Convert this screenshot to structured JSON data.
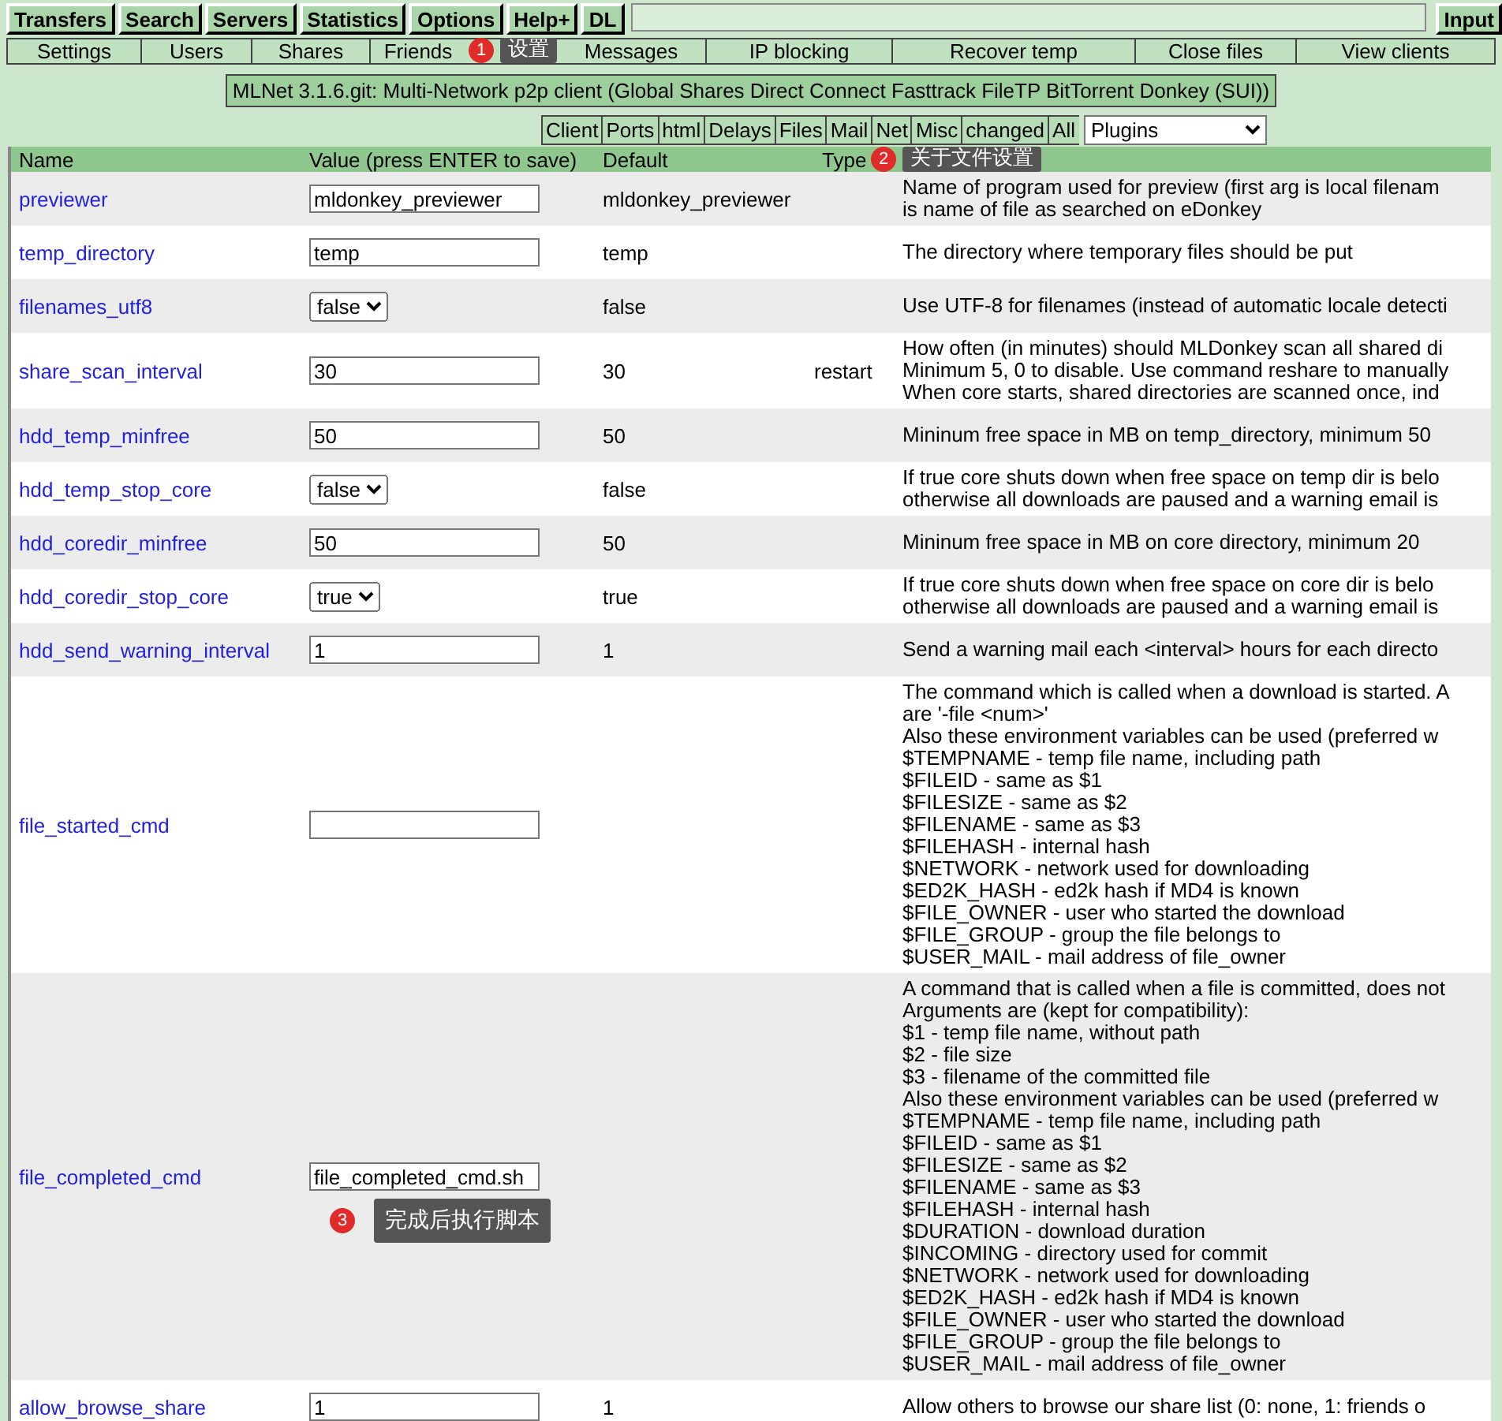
{
  "top_menu": [
    "Transfers",
    "Search",
    "Servers",
    "Statistics",
    "Options",
    "Help+",
    "DL"
  ],
  "input_button": "Input",
  "sub_menu": [
    "Settings",
    "Users",
    "Shares",
    "Friends",
    "Messages",
    "IP blocking",
    "Recover temp",
    "Close files",
    "View clients"
  ],
  "banner": "MLNet 3.1.6.git: Multi-Network p2p client (Global Shares Direct Connect Fasttrack FileTP BitTorrent Donkey (SUI))",
  "section_tabs": [
    "Client",
    "Ports",
    "html",
    "Delays",
    "Files",
    "Mail",
    "Net",
    "Misc",
    "changed",
    "All"
  ],
  "plugins_select": "Plugins",
  "table": {
    "columns": [
      "Name",
      "Value (press ENTER to save)",
      "Default",
      "Type"
    ],
    "rows": [
      {
        "name": "previewer",
        "kind": "text",
        "value": "mldonkey_previewer",
        "default": "mldonkey_previewer",
        "type": "",
        "help": [
          "Name of program used for preview (first arg is local filenam",
          "is name of file as searched on eDonkey"
        ]
      },
      {
        "name": "temp_directory",
        "kind": "text",
        "value": "temp",
        "default": "temp",
        "type": "",
        "help": [
          "The directory where temporary files should be put"
        ]
      },
      {
        "name": "filenames_utf8",
        "kind": "select",
        "value": "false",
        "default": "false",
        "type": "",
        "help": [
          "Use UTF-8 for filenames (instead of automatic locale detecti"
        ]
      },
      {
        "name": "share_scan_interval",
        "kind": "text",
        "value": "30",
        "default": "30",
        "type": "restart",
        "help": [
          "How often (in minutes) should MLDonkey scan all shared di",
          "Minimum 5, 0 to disable. Use command reshare to manually",
          "When core starts, shared directories are scanned once, ind"
        ]
      },
      {
        "name": "hdd_temp_minfree",
        "kind": "text",
        "value": "50",
        "default": "50",
        "type": "",
        "help": [
          "Mininum free space in MB on temp_directory, minimum 50"
        ]
      },
      {
        "name": "hdd_temp_stop_core",
        "kind": "select",
        "value": "false",
        "default": "false",
        "type": "",
        "help": [
          "If true core shuts down when free space on temp dir is belo",
          "otherwise all downloads are paused and a warning email is"
        ]
      },
      {
        "name": "hdd_coredir_minfree",
        "kind": "text",
        "value": "50",
        "default": "50",
        "type": "",
        "help": [
          "Mininum free space in MB on core directory, minimum 20"
        ]
      },
      {
        "name": "hdd_coredir_stop_core",
        "kind": "select",
        "value": "true",
        "default": "true",
        "type": "",
        "help": [
          "If true core shuts down when free space on core dir is belo",
          "otherwise all downloads are paused and a warning email is"
        ]
      },
      {
        "name": "hdd_send_warning_interval",
        "kind": "text",
        "value": "1",
        "default": "1",
        "type": "",
        "help": [
          "Send a warning mail each <interval> hours for each directo"
        ]
      },
      {
        "name": "file_started_cmd",
        "kind": "text",
        "value": "",
        "default": "",
        "type": "",
        "help": [
          "The command which is called when a download is started. A",
          "are '-file <num>'",
          "Also these environment variables can be used (preferred w",
          "$TEMPNAME - temp file name, including path",
          "$FILEID - same as $1",
          "$FILESIZE - same as $2",
          "$FILENAME - same as $3",
          "$FILEHASH - internal hash",
          "$NETWORK - network used for downloading",
          "$ED2K_HASH - ed2k hash if MD4 is known",
          "$FILE_OWNER - user who started the download",
          "$FILE_GROUP - group the file belongs to",
          "$USER_MAIL - mail address of file_owner"
        ]
      },
      {
        "name": "file_completed_cmd",
        "kind": "text",
        "value": "file_completed_cmd.sh",
        "default": "",
        "type": "",
        "help": [
          "A command that is called when a file is committed, does not",
          "Arguments are (kept for compatibility):",
          "$1 - temp file name, without path",
          "$2 - file size",
          "$3 - filename of the committed file",
          "Also these environment variables can be used (preferred w",
          "$TEMPNAME - temp file name, including path",
          "$FILEID - same as $1",
          "$FILESIZE - same as $2",
          "$FILENAME - same as $3",
          "$FILEHASH - internal hash",
          "$DURATION - download duration",
          "$INCOMING - directory used for commit",
          "$NETWORK - network used for downloading",
          "$ED2K_HASH - ed2k hash if MD4 is known",
          "$FILE_OWNER - user who started the download",
          "$FILE_GROUP - group the file belongs to",
          "$USER_MAIL - mail address of file_owner"
        ]
      },
      {
        "name": "allow_browse_share",
        "kind": "text",
        "value": "1",
        "default": "1",
        "type": "",
        "help": [
          "Allow others to browse our share list (0: none, 1: friends o"
        ]
      }
    ]
  },
  "annotations": [
    {
      "number": "1",
      "label": "设置"
    },
    {
      "number": "2",
      "label": "关于文件设置"
    },
    {
      "number": "3",
      "label": "完成后执行脚本"
    }
  ]
}
